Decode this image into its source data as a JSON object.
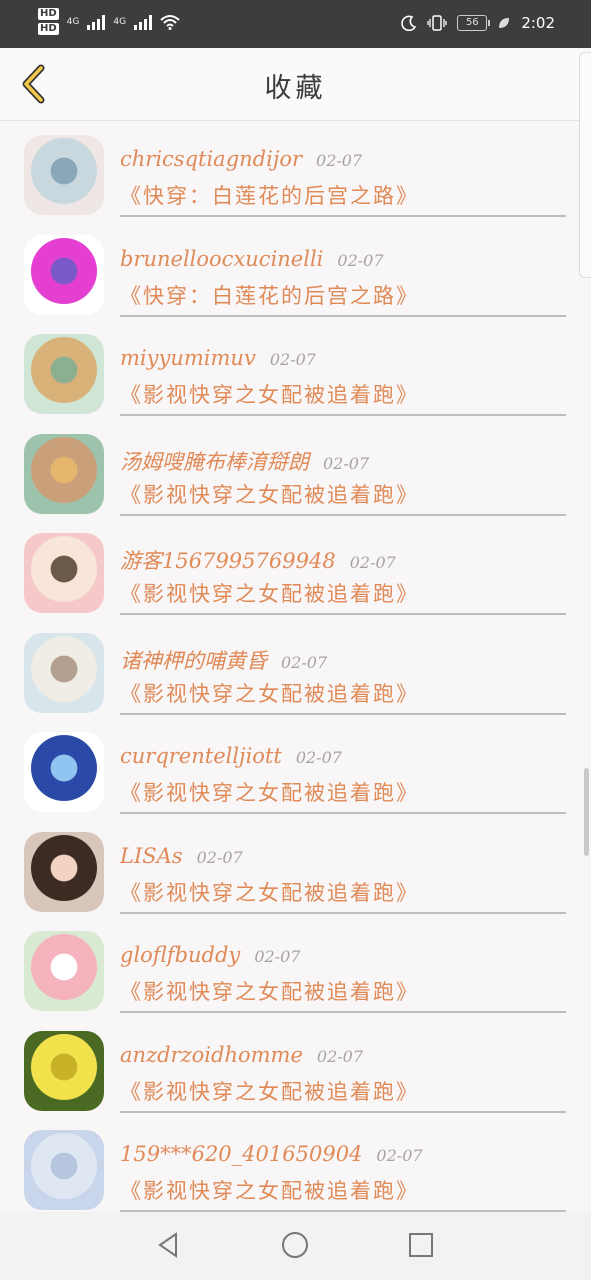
{
  "status_bar": {
    "hd1": "HD",
    "hd2": "HD",
    "net1": "4G",
    "net2": "4G",
    "battery": "56",
    "time": "2:02"
  },
  "header": {
    "title": "收藏"
  },
  "favorites": [
    {
      "user": "chricsqtiagndijor",
      "date": "02-07",
      "book": "《快穿：白莲花的后宫之路》",
      "avatar_colors": [
        "#efe7e6",
        "#c9d7de",
        "#8aa7b8"
      ]
    },
    {
      "user": "brunelloocxucinelli",
      "date": "02-07",
      "book": "《快穿：白莲花的后宫之路》",
      "avatar_colors": [
        "#ffffff",
        "#e43fd0",
        "#7a59c9"
      ]
    },
    {
      "user": "miyyumimuv",
      "date": "02-07",
      "book": "《影视快穿之女配被追着跑》",
      "avatar_colors": [
        "#cfe6d6",
        "#d9b27a",
        "#8cb08f"
      ]
    },
    {
      "user": "汤姆嗖腌布棒淯搿朗",
      "date": "02-07",
      "book": "《影视快穿之女配被追着跑》",
      "avatar_colors": [
        "#9ec3ad",
        "#c9a07a",
        "#e6b56e"
      ]
    },
    {
      "user": "游客1567995769948",
      "date": "02-07",
      "book": "《影视快穿之女配被追着跑》",
      "avatar_colors": [
        "#f5c9c9",
        "#f9e6d9",
        "#6b5a4a"
      ]
    },
    {
      "user": "诸神柙的哺黄昏",
      "date": "02-07",
      "book": "《影视快穿之女配被追着跑》",
      "avatar_colors": [
        "#d8e5ea",
        "#f0ece6",
        "#b3a090"
      ]
    },
    {
      "user": "curqrentelljiott",
      "date": "02-07",
      "book": "《影视快穿之女配被追着跑》",
      "avatar_colors": [
        "#ffffff",
        "#2b4aa8",
        "#8fc6f1"
      ]
    },
    {
      "user": "LISAs",
      "date": "02-07",
      "book": "《影视快穿之女配被追着跑》",
      "avatar_colors": [
        "#d8c6bb",
        "#3d2b23",
        "#f2d2c3"
      ]
    },
    {
      "user": "gloflfbuddy",
      "date": "02-07",
      "book": "《影视快穿之女配被追着跑》",
      "avatar_colors": [
        "#d9ead3",
        "#f5b3bd",
        "#ffffff"
      ]
    },
    {
      "user": "anzdrzoidhomme",
      "date": "02-07",
      "book": "《影视快穿之女配被追着跑》",
      "avatar_colors": [
        "#4a6a24",
        "#f2e24c",
        "#c8b227"
      ]
    },
    {
      "user": "159***620_401650904",
      "date": "02-07",
      "book": "《影视快穿之女配被追着跑》",
      "avatar_colors": [
        "#c9d5ea",
        "#dfe7f3",
        "#b7c6df"
      ]
    }
  ]
}
